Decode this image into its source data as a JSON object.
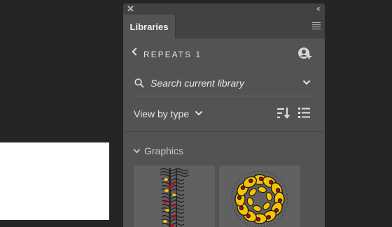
{
  "panel": {
    "active_tab": "Libraries",
    "library_name": "REPEATS 1",
    "search": {
      "placeholder": "Search current library"
    },
    "view": {
      "label": "View by type"
    },
    "section": {
      "label": "Graphics"
    },
    "icons": {
      "close": "close-icon",
      "collapse": "double-chevron-left-icon",
      "menu": "hamburger-menu-icon",
      "back": "chevron-left-icon",
      "share": "add-user-icon",
      "search": "search-icon",
      "dropdown": "chevron-down-icon",
      "sort": "sort-icon",
      "list_view": "list-view-icon",
      "section_toggle": "chevron-down-icon"
    },
    "colors": {
      "panel_bg": "#535353",
      "chrome_bg": "#424242",
      "thumb_bg": "#616161",
      "accent_yellow": "#f5c400",
      "accent_red": "#c8001e"
    }
  }
}
